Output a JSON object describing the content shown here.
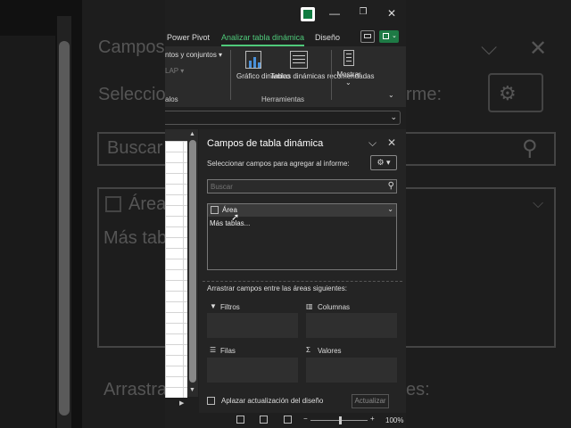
{
  "background": {
    "pane_title": "Campos",
    "select_text": "Selecciona",
    "inform_text": "rme:",
    "search_placeholder": "Buscar",
    "area_text": "Área",
    "more_text": "Más tabla",
    "drag_text_left": "Arrastra",
    "drag_text_right": "es:"
  },
  "ribbon": {
    "tabs": [
      "Power Pivot",
      "Analizar tabla dinámica",
      "Diseño"
    ],
    "active_tab": "Analizar tabla dinámica",
    "partial_item_1": "ntos y conjuntos",
    "partial_item_2": "LAP",
    "partial_group": "alos",
    "grafico_label": "Gráfico dinámico",
    "tablas_label": "Tablas dinámicas recomendadas",
    "mostrar_label": "Mostrar",
    "group_herramientas": "Herramientas"
  },
  "pane": {
    "title": "Campos de tabla dinámica",
    "subtitle": "Seleccionar campos para agregar al informe:",
    "search_placeholder": "Buscar",
    "field_area": "Área",
    "more_tables": "Más tablas...",
    "drag_hint": "Arrastrar campos entre las áreas siguientes:",
    "areas": {
      "filtros": "Filtros",
      "columnas": "Columnas",
      "filas": "Filas",
      "valores": "Valores"
    },
    "defer_update": "Aplazar actualización del diseño",
    "update_button": "Actualizar"
  },
  "status": {
    "zoom": "100%"
  },
  "colors": {
    "accent": "#4fc97a",
    "excel_green": "#107c41"
  }
}
